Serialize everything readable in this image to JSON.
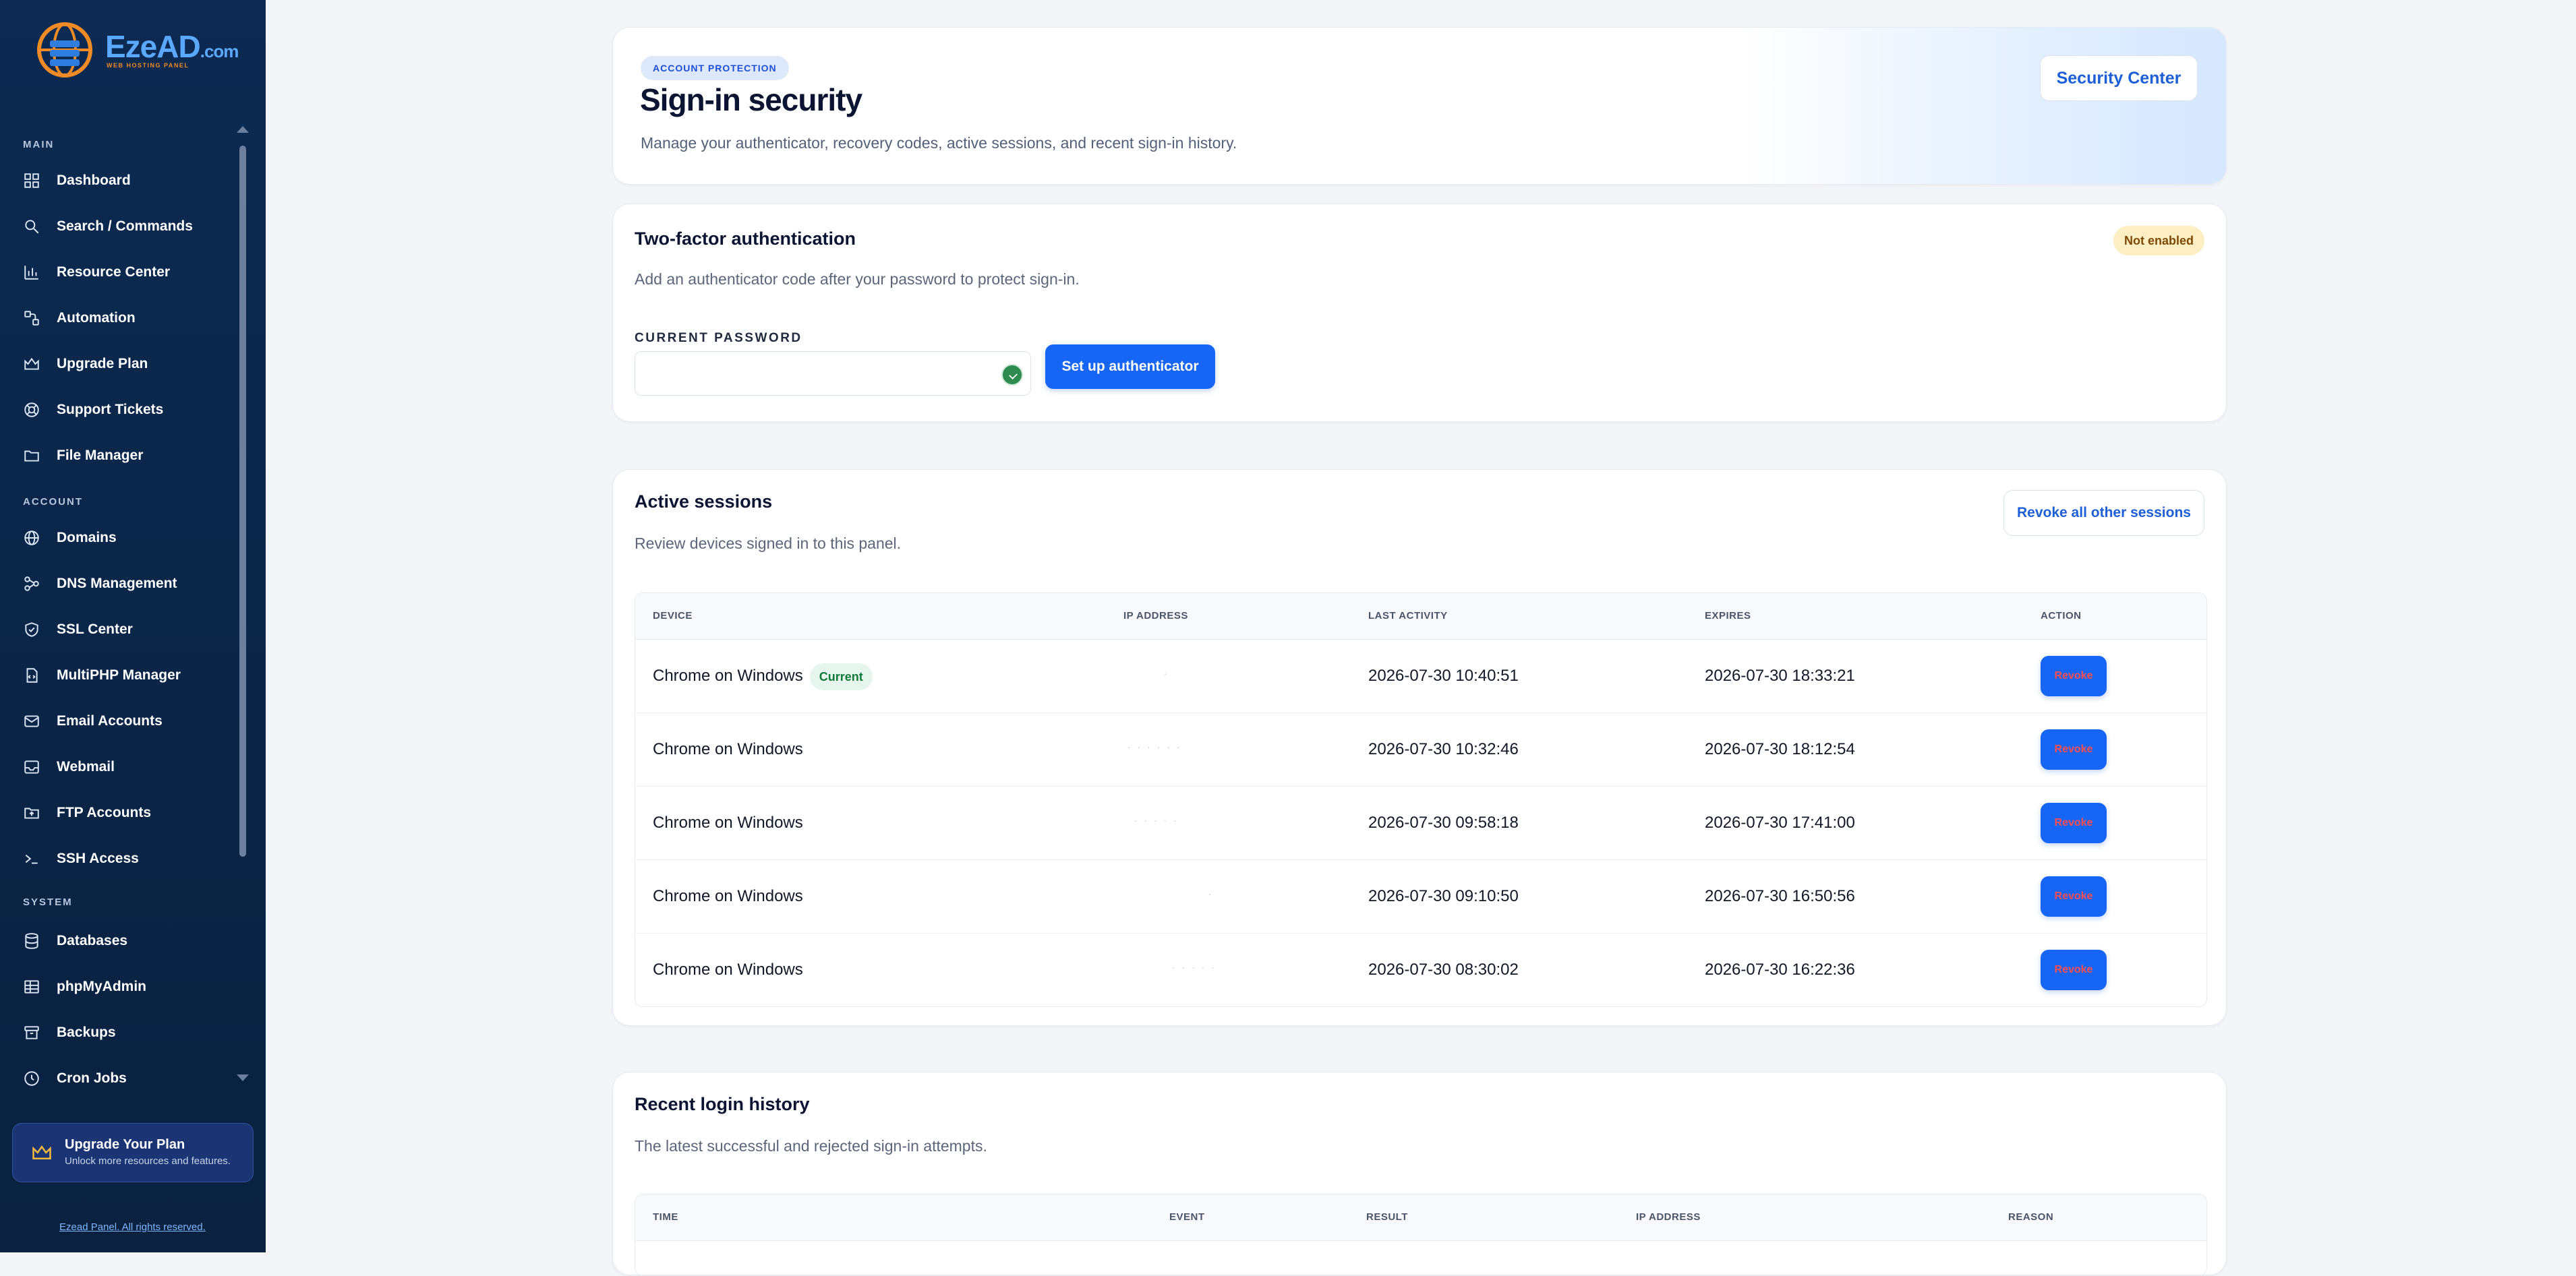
{
  "brand": {
    "name": "EzeAD",
    "tld": ".com",
    "tagline": "WEB HOSTING PANEL"
  },
  "sidebar": {
    "sections": [
      {
        "label": "MAIN"
      },
      {
        "label": "ACCOUNT"
      },
      {
        "label": "SYSTEM"
      }
    ],
    "items": [
      {
        "label": "Dashboard",
        "icon": "grid-icon"
      },
      {
        "label": "Search / Commands",
        "icon": "search-icon"
      },
      {
        "label": "Resource Center",
        "icon": "bar-chart-icon"
      },
      {
        "label": "Automation",
        "icon": "workflow-icon"
      },
      {
        "label": "Upgrade Plan",
        "icon": "crown-icon"
      },
      {
        "label": "Support Tickets",
        "icon": "lifebuoy-icon"
      },
      {
        "label": "File Manager",
        "icon": "folder-icon"
      },
      {
        "label": "Domains",
        "icon": "globe-icon"
      },
      {
        "label": "DNS Management",
        "icon": "network-icon"
      },
      {
        "label": "SSL Center",
        "icon": "shield-check-icon"
      },
      {
        "label": "MultiPHP Manager",
        "icon": "file-code-icon"
      },
      {
        "label": "Email Accounts",
        "icon": "mail-icon"
      },
      {
        "label": "Webmail",
        "icon": "inbox-icon"
      },
      {
        "label": "FTP Accounts",
        "icon": "folder-up-icon"
      },
      {
        "label": "SSH Access",
        "icon": "terminal-icon"
      },
      {
        "label": "Databases",
        "icon": "database-icon"
      },
      {
        "label": "phpMyAdmin",
        "icon": "table-icon"
      },
      {
        "label": "Backups",
        "icon": "archive-icon"
      },
      {
        "label": "Cron Jobs",
        "icon": "clock-icon"
      }
    ],
    "upgrade": {
      "title": "Upgrade Your Plan",
      "subtitle": "Unlock more resources and features."
    },
    "footer": "Ezead Panel. All rights reserved."
  },
  "hero": {
    "chip": "ACCOUNT PROTECTION",
    "title": "Sign-in security",
    "description": "Manage your authenticator, recovery codes, active sessions, and recent sign-in history.",
    "button": "Security Center"
  },
  "two_factor": {
    "title": "Two-factor authentication",
    "status": "Not enabled",
    "description": "Add an authenticator code after your password to protect sign-in.",
    "password_label": "CURRENT PASSWORD",
    "password_value": "",
    "button": "Set up authenticator"
  },
  "sessions": {
    "title": "Active sessions",
    "description": "Review devices signed in to this panel.",
    "revoke_all": "Revoke all other sessions",
    "columns": [
      "DEVICE",
      "IP ADDRESS",
      "LAST ACTIVITY",
      "EXPIRES",
      "ACTION"
    ],
    "current_label": "Current",
    "action_label": "Revoke",
    "rows": [
      {
        "device": "Chrome on Windows",
        "current": true,
        "last_activity": "2026-07-30 10:40:51",
        "expires": "2026-07-30 18:33:21"
      },
      {
        "device": "Chrome on Windows",
        "current": false,
        "last_activity": "2026-07-30 10:32:46",
        "expires": "2026-07-30 18:12:54"
      },
      {
        "device": "Chrome on Windows",
        "current": false,
        "last_activity": "2026-07-30 09:58:18",
        "expires": "2026-07-30 17:41:00"
      },
      {
        "device": "Chrome on Windows",
        "current": false,
        "last_activity": "2026-07-30 09:10:50",
        "expires": "2026-07-30 16:50:56"
      },
      {
        "device": "Chrome on Windows",
        "current": false,
        "last_activity": "2026-07-30 08:30:02",
        "expires": "2026-07-30 16:22:36"
      }
    ]
  },
  "history": {
    "title": "Recent login history",
    "description": "The latest successful and rejected sign-in attempts.",
    "columns": [
      "TIME",
      "EVENT",
      "RESULT",
      "IP ADDRESS",
      "REASON"
    ]
  },
  "colors": {
    "accent": "#1765f5",
    "sidebar": "#0c2a52",
    "warning_bg": "#fdeec4",
    "success_bg": "#e6f6ec",
    "revoke_text": "#ff4d4f"
  }
}
